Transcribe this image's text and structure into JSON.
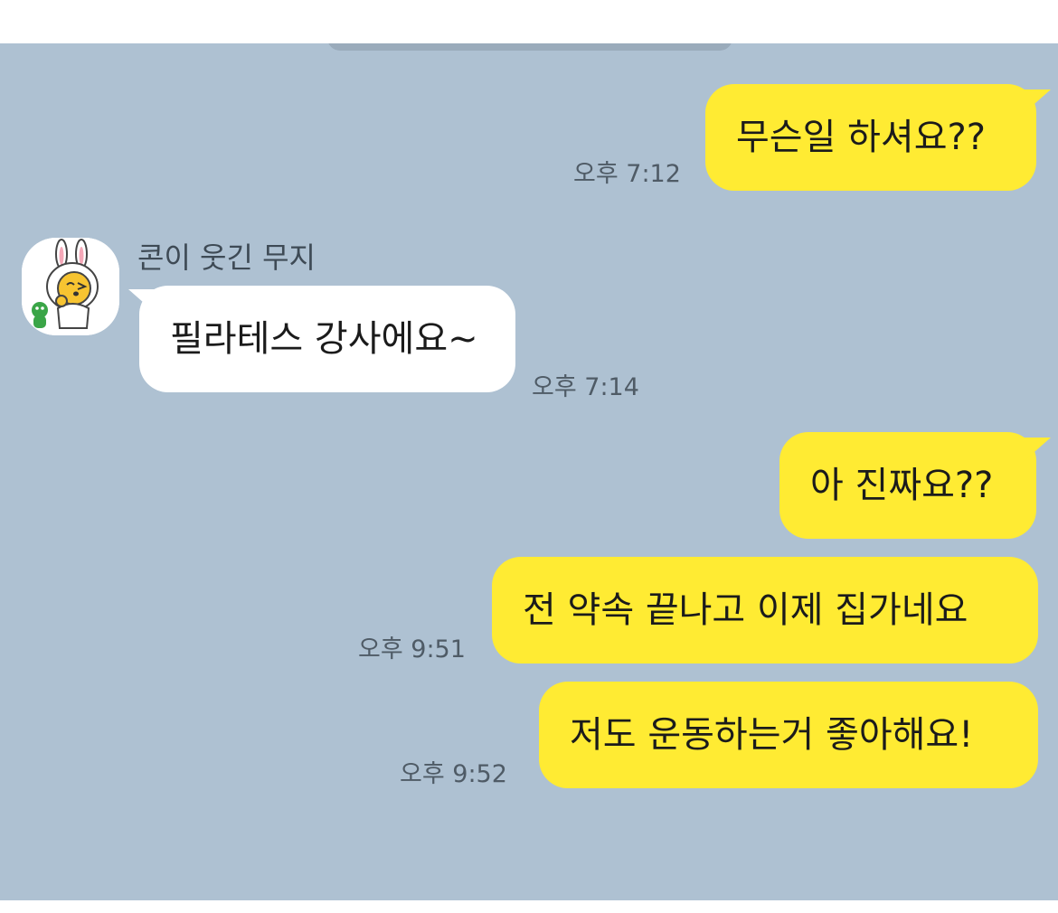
{
  "chat": {
    "messages": [
      {
        "from": "me",
        "text": "무슨일 하셔요??",
        "time": "오후 7:12"
      },
      {
        "from": "other",
        "sender": "콘이 웃긴 무지",
        "text": "필라테스 강사에요~",
        "time": "오후 7:14"
      },
      {
        "from": "me",
        "text": "아 진짜요??",
        "time": ""
      },
      {
        "from": "me",
        "text": "전 약속 끝나고 이제 집가네요",
        "time": "오후 9:51"
      },
      {
        "from": "me",
        "text": "저도 운동하는거 좋아해요!",
        "time": "오후 9:52"
      }
    ],
    "avatar_icon": "rabbit-character-icon"
  },
  "colors": {
    "chat_background": "#aec1d2",
    "my_bubble": "#ffeb33",
    "other_bubble": "#ffffff"
  }
}
